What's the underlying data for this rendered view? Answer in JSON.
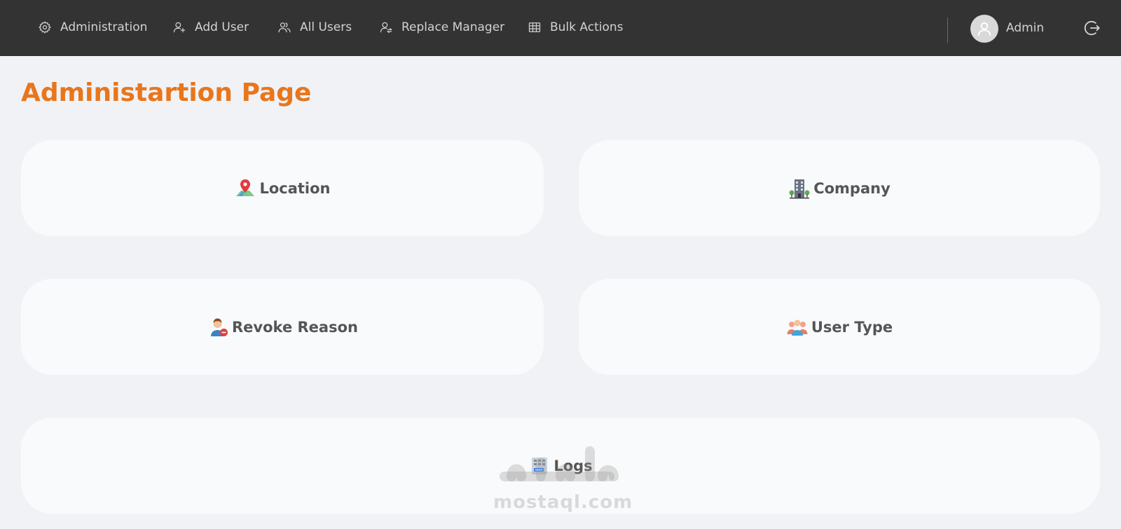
{
  "nav": {
    "items": [
      {
        "label": "Administration",
        "icon": "gear-icon"
      },
      {
        "label": "Add User",
        "icon": "user-plus-icon"
      },
      {
        "label": "All Users",
        "icon": "users-icon"
      },
      {
        "label": "Replace Manager",
        "icon": "user-switch-icon"
      },
      {
        "label": "Bulk Actions",
        "icon": "table-icon"
      }
    ],
    "user_name": "Admin",
    "avatar_icon": "user-avatar-icon",
    "logout_icon": "logout-icon"
  },
  "page": {
    "title": "Administartion Page"
  },
  "cards": [
    {
      "label": "Location",
      "icon": "map-pin-icon"
    },
    {
      "label": "Company",
      "icon": "building-icon"
    },
    {
      "label": "Revoke Reason",
      "icon": "user-revoke-icon"
    },
    {
      "label": "User Type",
      "icon": "user-group-icon"
    },
    {
      "label": "Logs",
      "icon": "logs-icon"
    }
  ],
  "watermark": {
    "text": "mostaql.com"
  },
  "colors": {
    "topbar": "#333333",
    "background": "#f1f2f6",
    "card": "#f9fafb",
    "title_accent": "#e8761c",
    "card_text": "#555555",
    "nav_text": "#d2d2d2"
  }
}
